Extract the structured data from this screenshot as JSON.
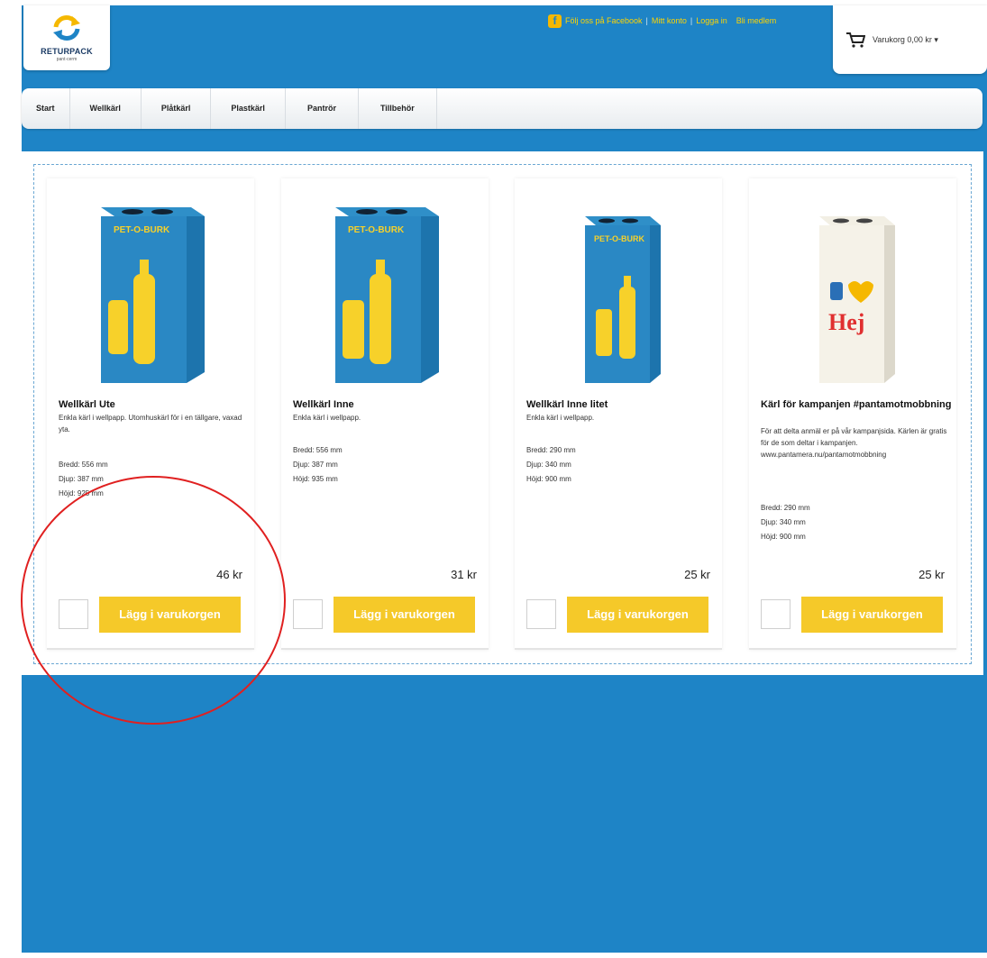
{
  "logo": {
    "name": "RETURPACK",
    "sub": "pant·cerm"
  },
  "toplinks": {
    "facebook": "Följ oss på Facebook",
    "account": "Mitt konto",
    "login": "Logga in",
    "media": "Bli medlem"
  },
  "cart": {
    "label": "Varukorg 0,00 kr ▾"
  },
  "nav": [
    "Start",
    "Wellkärl",
    "Plåtkärl",
    "Plastkärl",
    "Pantrör",
    "Tillbehör"
  ],
  "products": [
    {
      "box": "PET-O-BURK",
      "title": "Wellkärl Ute",
      "desc": "Enkla kärl i wellpapp. Utomhuskärl för i en tällgare, vaxad yta.",
      "specs": [
        "Bredd: 556 mm",
        "Djup: 387 mm",
        "Höjd: 925 mm"
      ],
      "price": "46 kr",
      "button": "Lägg i varukorgen"
    },
    {
      "box": "PET-O-BURK",
      "title": "Wellkärl Inne",
      "desc": "Enkla kärl i wellpapp.",
      "specs": [
        "Bredd: 556 mm",
        "Djup: 387 mm",
        "Höjd: 935 mm"
      ],
      "price": "31 kr",
      "button": "Lägg i varukorgen"
    },
    {
      "box": "PET-O-BURK",
      "title": "Wellkärl Inne litet",
      "desc": "Enkla kärl i wellpapp.",
      "specs": [
        "Bredd: 290 mm",
        "Djup: 340 mm",
        "Höjd: 900 mm"
      ],
      "price": "25 kr",
      "button": "Lägg i varukorgen"
    },
    {
      "box": "Hej",
      "title": "Kärl för kampanjen #pantamotmobbning",
      "desc": "För att delta anmäl er på vår kampanjsida. Kärlen är gratis för de som deltar i kampanjen. www.pantamera.nu/pantamotmobbning",
      "specs": [
        "Bredd: 290 mm",
        "Djup: 340 mm",
        "Höjd: 900 mm"
      ],
      "price": "25 kr",
      "button": "Lägg i varukorgen"
    }
  ],
  "colors": {
    "site_blue": "#1e84c6",
    "accent_yellow": "#f5c929",
    "annotation_red": "#e02020"
  }
}
